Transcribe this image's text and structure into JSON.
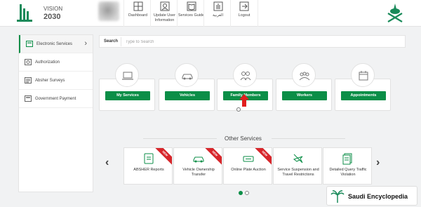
{
  "header": {
    "vision_logo_text": "VISION 2030",
    "nav": [
      {
        "label": "Dashboard",
        "icon": "grid-icon"
      },
      {
        "label": "Update User Information",
        "icon": "user-edit-icon"
      },
      {
        "label": "Services Guide",
        "icon": "book-icon"
      },
      {
        "label": "العربية",
        "icon": "hand-icon"
      },
      {
        "label": "Logout",
        "icon": "logout-icon"
      }
    ],
    "emblem": "saudi-emblem-icon"
  },
  "sidebar": {
    "items": [
      {
        "label": "Electronic Services",
        "icon": "services-icon",
        "active": true
      },
      {
        "label": "Authorization",
        "icon": "authorization-icon",
        "active": false
      },
      {
        "label": "Absher Surveys",
        "icon": "survey-icon",
        "active": false
      },
      {
        "label": "Government Payment",
        "icon": "payment-icon",
        "active": false
      }
    ]
  },
  "search": {
    "label": "Search",
    "placeholder": "Type to Search"
  },
  "services": [
    {
      "label": "My Services",
      "icon": "laptop-icon"
    },
    {
      "label": "Vehicles",
      "icon": "car-icon"
    },
    {
      "label": "Family Members",
      "icon": "family-icon"
    },
    {
      "label": "Workers",
      "icon": "workers-icon"
    },
    {
      "label": "Appointments",
      "icon": "calendar-icon"
    }
  ],
  "other_services": {
    "title": "Other Services",
    "items": [
      {
        "label": "ABSHER Reports",
        "icon": "report-icon",
        "badge": "NEW"
      },
      {
        "label": "Vehicle Ownership Transfer",
        "icon": "car-transfer-icon",
        "badge": "NEW"
      },
      {
        "label": "Online Plate Auction",
        "icon": "plate-icon",
        "badge": "NEW"
      },
      {
        "label": "Service Suspension and Travel Restrictions",
        "icon": "plane-off-icon",
        "badge": ""
      },
      {
        "label": "Detailed Query Traffic Violation",
        "icon": "document-icon",
        "badge": ""
      }
    ],
    "pagination": {
      "current": 1,
      "total": 2
    }
  },
  "watermark": {
    "text": "Saudi Encyclopedia"
  },
  "colors": {
    "primary_green": "#0b8e47",
    "badge_red": "#d7262b",
    "arrow_red": "#e01e1e"
  }
}
